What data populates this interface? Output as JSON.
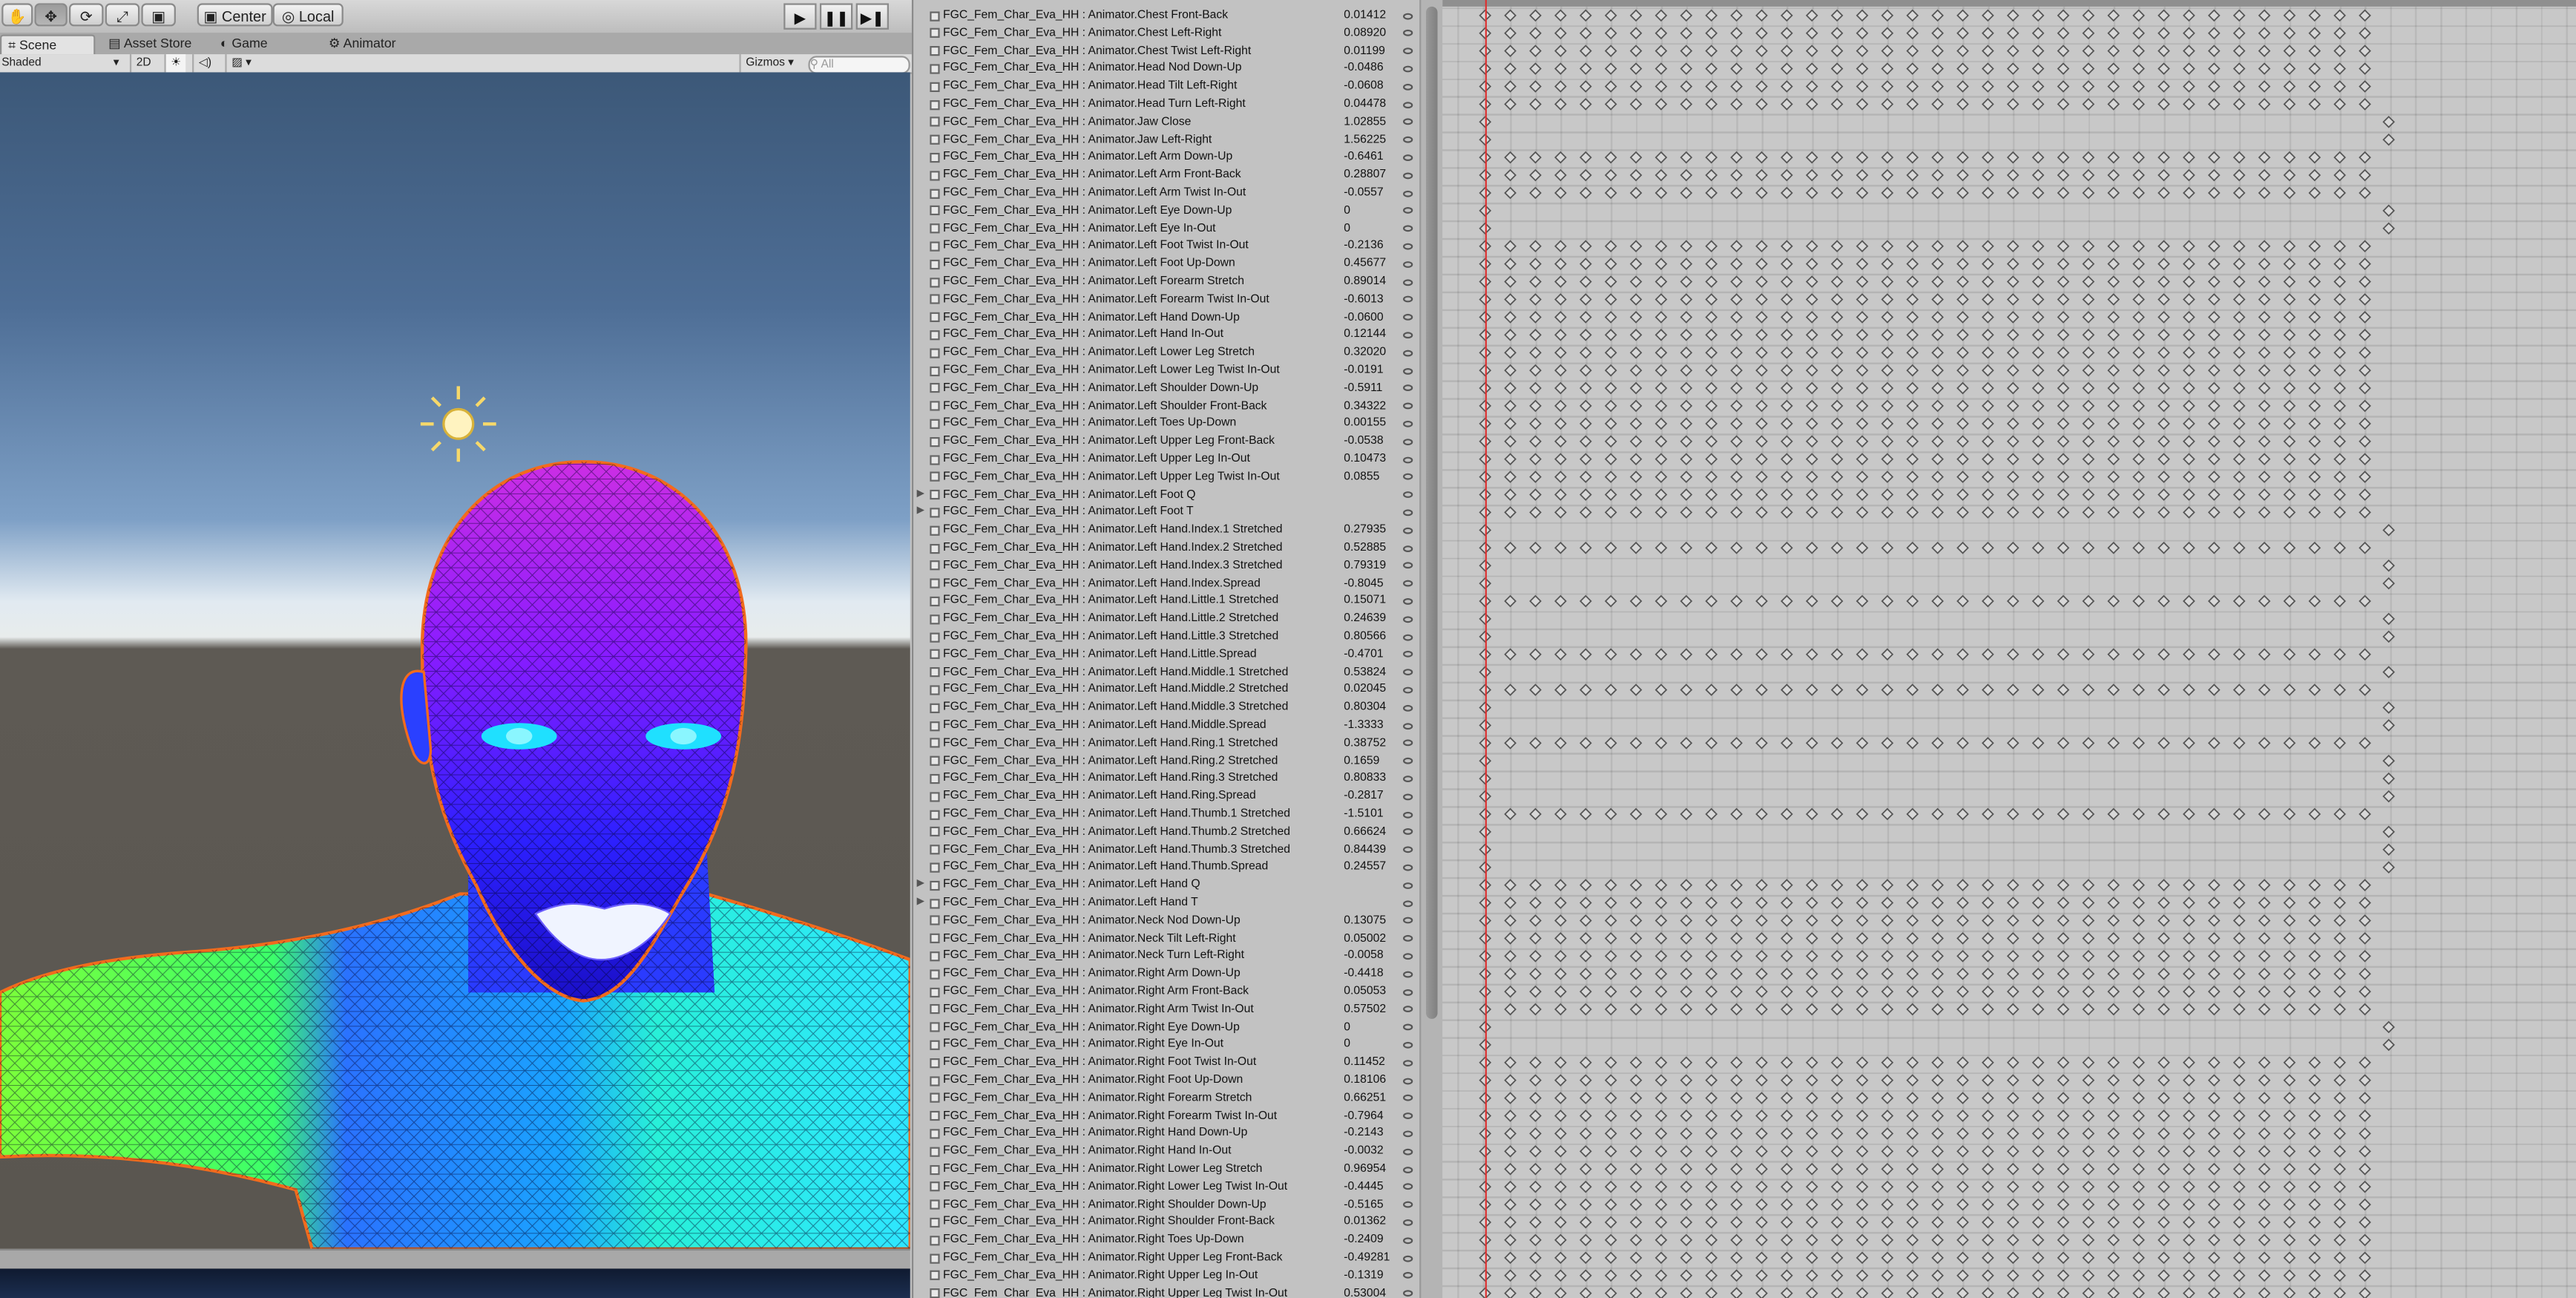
{
  "toolbar": {
    "pivot_label": "Center",
    "space_label": "Local",
    "play_icon": "play-icon",
    "pause_icon": "pause-icon",
    "step_icon": "step-icon"
  },
  "tabs": [
    {
      "label": "Scene"
    },
    {
      "label": "Asset Store"
    },
    {
      "label": "Game"
    },
    {
      "label": "Animator"
    }
  ],
  "scene_bar": {
    "shading_mode": "Shaded",
    "mode_2d": "2D",
    "gizmos_label": "Gizmos",
    "search_placeholder": "All"
  },
  "colors": {
    "playhead": "#dd3333",
    "key_fill": "#d8d8d8",
    "key_stroke": "#555555",
    "selection_outline": "#f26b1d"
  },
  "properties": [
    {
      "name": "FGC_Fem_Char_Eva_HH : Animator.Chest Front-Back",
      "value": "0.01412"
    },
    {
      "name": "FGC_Fem_Char_Eva_HH : Animator.Chest Left-Right",
      "value": "0.08920"
    },
    {
      "name": "FGC_Fem_Char_Eva_HH : Animator.Chest Twist Left-Right",
      "value": "0.01199"
    },
    {
      "name": "FGC_Fem_Char_Eva_HH : Animator.Head Nod Down-Up",
      "value": "-0.0486"
    },
    {
      "name": "FGC_Fem_Char_Eva_HH : Animator.Head Tilt Left-Right",
      "value": "-0.0608"
    },
    {
      "name": "FGC_Fem_Char_Eva_HH : Animator.Head Turn Left-Right",
      "value": "0.04478"
    },
    {
      "name": "FGC_Fem_Char_Eva_HH : Animator.Jaw Close",
      "value": "1.02855"
    },
    {
      "name": "FGC_Fem_Char_Eva_HH : Animator.Jaw Left-Right",
      "value": "1.56225"
    },
    {
      "name": "FGC_Fem_Char_Eva_HH : Animator.Left Arm Down-Up",
      "value": "-0.6461"
    },
    {
      "name": "FGC_Fem_Char_Eva_HH : Animator.Left Arm Front-Back",
      "value": "0.28807"
    },
    {
      "name": "FGC_Fem_Char_Eva_HH : Animator.Left Arm Twist In-Out",
      "value": "-0.0557"
    },
    {
      "name": "FGC_Fem_Char_Eva_HH : Animator.Left Eye Down-Up",
      "value": "0"
    },
    {
      "name": "FGC_Fem_Char_Eva_HH : Animator.Left Eye In-Out",
      "value": "0"
    },
    {
      "name": "FGC_Fem_Char_Eva_HH : Animator.Left Foot Twist In-Out",
      "value": "-0.2136"
    },
    {
      "name": "FGC_Fem_Char_Eva_HH : Animator.Left Foot Up-Down",
      "value": "0.45677"
    },
    {
      "name": "FGC_Fem_Char_Eva_HH : Animator.Left Forearm Stretch",
      "value": "0.89014"
    },
    {
      "name": "FGC_Fem_Char_Eva_HH : Animator.Left Forearm Twist In-Out",
      "value": "-0.6013"
    },
    {
      "name": "FGC_Fem_Char_Eva_HH : Animator.Left Hand Down-Up",
      "value": "-0.0600"
    },
    {
      "name": "FGC_Fem_Char_Eva_HH : Animator.Left Hand In-Out",
      "value": "0.12144"
    },
    {
      "name": "FGC_Fem_Char_Eva_HH : Animator.Left Lower Leg Stretch",
      "value": "0.32020"
    },
    {
      "name": "FGC_Fem_Char_Eva_HH : Animator.Left Lower Leg Twist In-Out",
      "value": "-0.0191"
    },
    {
      "name": "FGC_Fem_Char_Eva_HH : Animator.Left Shoulder Down-Up",
      "value": "-0.5911"
    },
    {
      "name": "FGC_Fem_Char_Eva_HH : Animator.Left Shoulder Front-Back",
      "value": "0.34322"
    },
    {
      "name": "FGC_Fem_Char_Eva_HH : Animator.Left Toes Up-Down",
      "value": "0.00155"
    },
    {
      "name": "FGC_Fem_Char_Eva_HH : Animator.Left Upper Leg Front-Back",
      "value": "-0.0538"
    },
    {
      "name": "FGC_Fem_Char_Eva_HH : Animator.Left Upper Leg In-Out",
      "value": "0.10473"
    },
    {
      "name": "FGC_Fem_Char_Eva_HH : Animator.Left Upper Leg Twist In-Out",
      "value": "0.0855"
    },
    {
      "name": "FGC_Fem_Char_Eva_HH : Animator.Left Foot Q",
      "value": "",
      "fold": true
    },
    {
      "name": "FGC_Fem_Char_Eva_HH : Animator.Left Foot T",
      "value": "",
      "fold": true
    },
    {
      "name": "FGC_Fem_Char_Eva_HH : Animator.Left Hand.Index.1 Stretched",
      "value": "0.27935"
    },
    {
      "name": "FGC_Fem_Char_Eva_HH : Animator.Left Hand.Index.2 Stretched",
      "value": "0.52885"
    },
    {
      "name": "FGC_Fem_Char_Eva_HH : Animator.Left Hand.Index.3 Stretched",
      "value": "0.79319"
    },
    {
      "name": "FGC_Fem_Char_Eva_HH : Animator.Left Hand.Index.Spread",
      "value": "-0.8045"
    },
    {
      "name": "FGC_Fem_Char_Eva_HH : Animator.Left Hand.Little.1 Stretched",
      "value": "0.15071"
    },
    {
      "name": "FGC_Fem_Char_Eva_HH : Animator.Left Hand.Little.2 Stretched",
      "value": "0.24639"
    },
    {
      "name": "FGC_Fem_Char_Eva_HH : Animator.Left Hand.Little.3 Stretched",
      "value": "0.80566"
    },
    {
      "name": "FGC_Fem_Char_Eva_HH : Animator.Left Hand.Little.Spread",
      "value": "-0.4701"
    },
    {
      "name": "FGC_Fem_Char_Eva_HH : Animator.Left Hand.Middle.1 Stretched",
      "value": "0.53824"
    },
    {
      "name": "FGC_Fem_Char_Eva_HH : Animator.Left Hand.Middle.2 Stretched",
      "value": "0.02045"
    },
    {
      "name": "FGC_Fem_Char_Eva_HH : Animator.Left Hand.Middle.3 Stretched",
      "value": "0.80304"
    },
    {
      "name": "FGC_Fem_Char_Eva_HH : Animator.Left Hand.Middle.Spread",
      "value": "-1.3333"
    },
    {
      "name": "FGC_Fem_Char_Eva_HH : Animator.Left Hand.Ring.1 Stretched",
      "value": "0.38752"
    },
    {
      "name": "FGC_Fem_Char_Eva_HH : Animator.Left Hand.Ring.2 Stretched",
      "value": "0.1659"
    },
    {
      "name": "FGC_Fem_Char_Eva_HH : Animator.Left Hand.Ring.3 Stretched",
      "value": "0.80833"
    },
    {
      "name": "FGC_Fem_Char_Eva_HH : Animator.Left Hand.Ring.Spread",
      "value": "-0.2817"
    },
    {
      "name": "FGC_Fem_Char_Eva_HH : Animator.Left Hand.Thumb.1 Stretched",
      "value": "-1.5101"
    },
    {
      "name": "FGC_Fem_Char_Eva_HH : Animator.Left Hand.Thumb.2 Stretched",
      "value": "0.66624"
    },
    {
      "name": "FGC_Fem_Char_Eva_HH : Animator.Left Hand.Thumb.3 Stretched",
      "value": "0.84439"
    },
    {
      "name": "FGC_Fem_Char_Eva_HH : Animator.Left Hand.Thumb.Spread",
      "value": "0.24557"
    },
    {
      "name": "FGC_Fem_Char_Eva_HH : Animator.Left Hand Q",
      "value": "",
      "fold": true
    },
    {
      "name": "FGC_Fem_Char_Eva_HH : Animator.Left Hand T",
      "value": "",
      "fold": true
    },
    {
      "name": "FGC_Fem_Char_Eva_HH : Animator.Neck Nod Down-Up",
      "value": "0.13075"
    },
    {
      "name": "FGC_Fem_Char_Eva_HH : Animator.Neck Tilt Left-Right",
      "value": "0.05002"
    },
    {
      "name": "FGC_Fem_Char_Eva_HH : Animator.Neck Turn Left-Right",
      "value": "-0.0058"
    },
    {
      "name": "FGC_Fem_Char_Eva_HH : Animator.Right Arm Down-Up",
      "value": "-0.4418"
    },
    {
      "name": "FGC_Fem_Char_Eva_HH : Animator.Right Arm Front-Back",
      "value": "0.05053"
    },
    {
      "name": "FGC_Fem_Char_Eva_HH : Animator.Right Arm Twist In-Out",
      "value": "0.57502"
    },
    {
      "name": "FGC_Fem_Char_Eva_HH : Animator.Right Eye Down-Up",
      "value": "0"
    },
    {
      "name": "FGC_Fem_Char_Eva_HH : Animator.Right Eye In-Out",
      "value": "0"
    },
    {
      "name": "FGC_Fem_Char_Eva_HH : Animator.Right Foot Twist In-Out",
      "value": "0.11452"
    },
    {
      "name": "FGC_Fem_Char_Eva_HH : Animator.Right Foot Up-Down",
      "value": "0.18106"
    },
    {
      "name": "FGC_Fem_Char_Eva_HH : Animator.Right Forearm Stretch",
      "value": "0.66251"
    },
    {
      "name": "FGC_Fem_Char_Eva_HH : Animator.Right Forearm Twist In-Out",
      "value": "-0.7964"
    },
    {
      "name": "FGC_Fem_Char_Eva_HH : Animator.Right Hand Down-Up",
      "value": "-0.2143"
    },
    {
      "name": "FGC_Fem_Char_Eva_HH : Animator.Right Hand In-Out",
      "value": "-0.0032"
    },
    {
      "name": "FGC_Fem_Char_Eva_HH : Animator.Right Lower Leg Stretch",
      "value": "0.96954"
    },
    {
      "name": "FGC_Fem_Char_Eva_HH : Animator.Right Lower Leg Twist In-Out",
      "value": "-0.4445"
    },
    {
      "name": "FGC_Fem_Char_Eva_HH : Animator.Right Shoulder Down-Up",
      "value": "-0.5165"
    },
    {
      "name": "FGC_Fem_Char_Eva_HH : Animator.Right Shoulder Front-Back",
      "value": "0.01362"
    },
    {
      "name": "FGC_Fem_Char_Eva_HH : Animator.Right Toes Up-Down",
      "value": "-0.2409"
    },
    {
      "name": "FGC_Fem_Char_Eva_HH : Animator.Right Upper Leg Front-Back",
      "value": "-0.49281"
    },
    {
      "name": "FGC_Fem_Char_Eva_HH : Animator.Right Upper Leg In-Out",
      "value": "-0.1319"
    },
    {
      "name": "FGC_Fem_Char_Eva_HH : Animator.Right Upper Leg Twist In-Out",
      "value": "0.53004"
    }
  ]
}
